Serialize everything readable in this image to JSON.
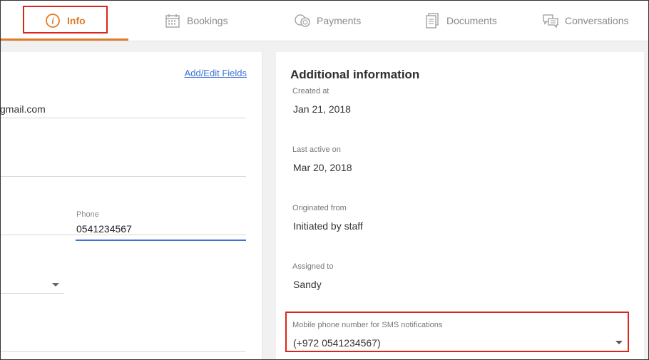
{
  "tabs": [
    {
      "label": "Info",
      "icon": "info-icon",
      "active": true
    },
    {
      "label": "Bookings",
      "icon": "calendar-icon",
      "active": false
    },
    {
      "label": "Payments",
      "icon": "coins-icon",
      "active": false
    },
    {
      "label": "Documents",
      "icon": "documents-icon",
      "active": false
    },
    {
      "label": "Conversations",
      "icon": "chat-icon",
      "active": false
    }
  ],
  "colors": {
    "accent": "#e07b2a",
    "highlight": "#d9261c",
    "link": "#3b74d4"
  },
  "left_panel": {
    "add_edit_link": "Add/Edit Fields",
    "email_value": "gmail.com",
    "phone_label": "Phone",
    "phone_value": "0541234567"
  },
  "additional_info": {
    "title": "Additional information",
    "fields": [
      {
        "label": "Created at",
        "value": "Jan 21, 2018"
      },
      {
        "label": "Last active on",
        "value": "Mar 20, 2018"
      },
      {
        "label": "Originated from",
        "value": "Initiated by staff"
      },
      {
        "label": "Assigned to",
        "value": "Sandy"
      }
    ],
    "sms": {
      "label": "Mobile phone number for SMS notifications",
      "value": "(+972 0541234567)"
    }
  }
}
